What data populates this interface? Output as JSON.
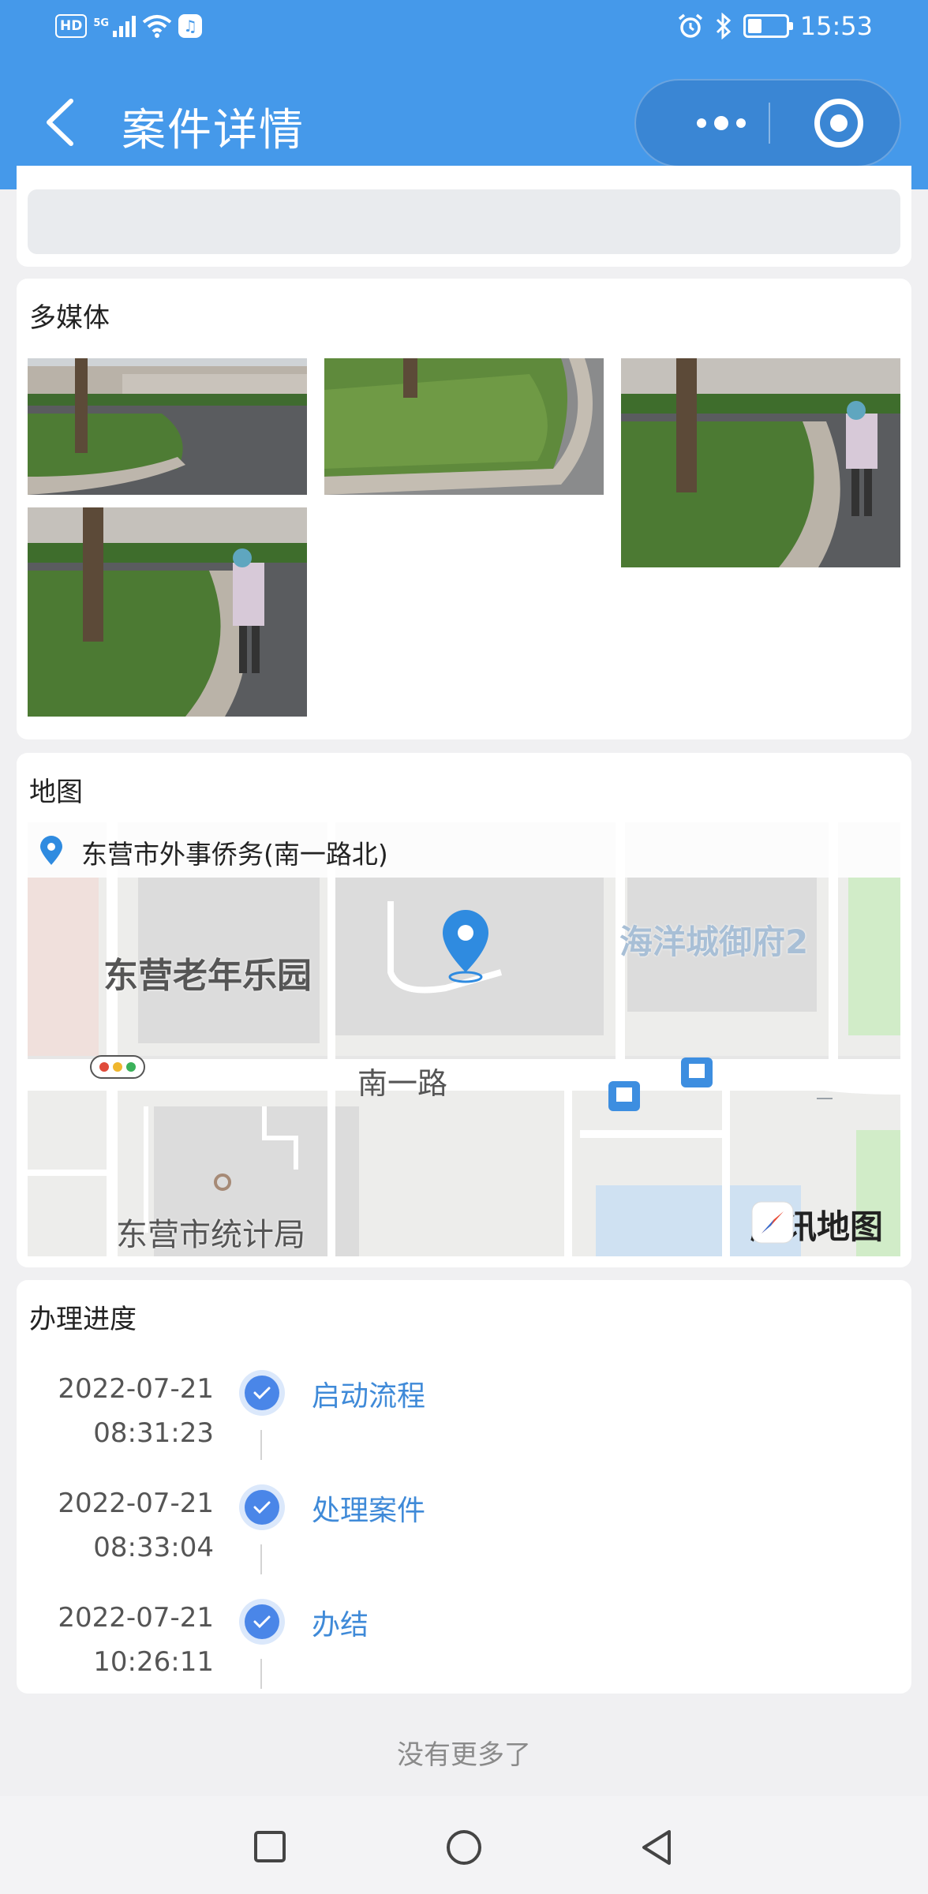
{
  "status_bar": {
    "left_badge": "HD",
    "network": "5G",
    "time": "15:53"
  },
  "nav": {
    "title": "案件详情"
  },
  "media": {
    "title": "多媒体"
  },
  "map": {
    "title": "地图",
    "address": "东营市外事侨务(南一路北)",
    "labels": {
      "park": "东营老年乐园",
      "estate": "海洋城御府2",
      "road": "南一路",
      "bureau": "东营市统计局"
    },
    "provider": "腾讯地图"
  },
  "progress": {
    "title": "办理进度",
    "steps": [
      {
        "date": "2022-07-21",
        "time": "08:31:23",
        "label": "启动流程"
      },
      {
        "date": "2022-07-21",
        "time": "08:33:04",
        "label": "处理案件"
      },
      {
        "date": "2022-07-21",
        "time": "10:26:11",
        "label": "办结"
      }
    ]
  },
  "footer": {
    "no_more": "没有更多了"
  },
  "colors": {
    "header_blue": "#4599ea",
    "link_blue": "#3f8ad8",
    "check_blue": "#4a86e8"
  }
}
